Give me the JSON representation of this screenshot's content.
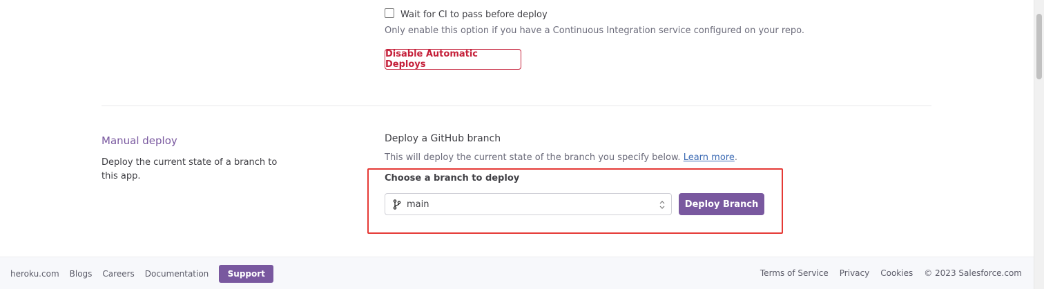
{
  "automatic_deploys": {
    "ci_checkbox_label": "Wait for CI to pass before deploy",
    "ci_checked": false,
    "ci_help": "Only enable this option if you have a Continuous Integration service configured on your repo.",
    "disable_button": "Disable Automatic Deploys"
  },
  "manual_deploy": {
    "title": "Manual deploy",
    "description": "Deploy the current state of a branch to this app.",
    "deploy_heading": "Deploy a GitHub branch",
    "help_text": "This will deploy the current state of the branch you specify below.",
    "learn_more": "Learn more",
    "help_suffix": ".",
    "choose_label": "Choose a branch to deploy",
    "branch_value": "main",
    "branch_icon": "git-branch-icon",
    "deploy_button": "Deploy Branch"
  },
  "footer": {
    "links": [
      "heroku.com",
      "Blogs",
      "Careers",
      "Documentation"
    ],
    "support": "Support",
    "right_links": [
      "Terms of Service",
      "Privacy",
      "Cookies"
    ],
    "copyright": "© 2023 Salesforce.com"
  },
  "colors": {
    "accent": "#79589f",
    "danger": "#c5203a",
    "highlight": "#e53935",
    "link": "#3d6bb4"
  }
}
